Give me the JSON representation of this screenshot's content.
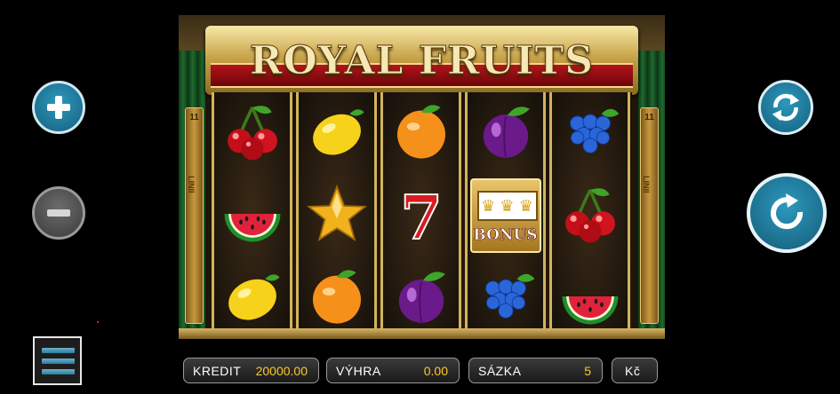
{
  "title": "ROYAL FRUITS",
  "paylines": {
    "count": "11",
    "label": "LINII"
  },
  "reels": [
    [
      "cherry",
      "watermelon",
      "lemon"
    ],
    [
      "lemon",
      "star",
      "orange"
    ],
    [
      "orange",
      "seven",
      "plum"
    ],
    [
      "plum",
      "bonus",
      "grapes"
    ],
    [
      "grapes",
      "cherry",
      "watermelon"
    ]
  ],
  "bonus_label": "BONUS",
  "seven_label": "7",
  "stats": {
    "kredit_label": "KREDIT",
    "kredit_value": "20000.00",
    "vyhra_label": "VÝHRA",
    "vyhra_value": "0.00",
    "sazka_label": "SÁZKA",
    "sazka_value": "5",
    "currency": "Kč"
  },
  "colors": {
    "button_blue": "#2c98be",
    "value_yellow": "#ffc72c",
    "header_red": "#b5141b"
  }
}
